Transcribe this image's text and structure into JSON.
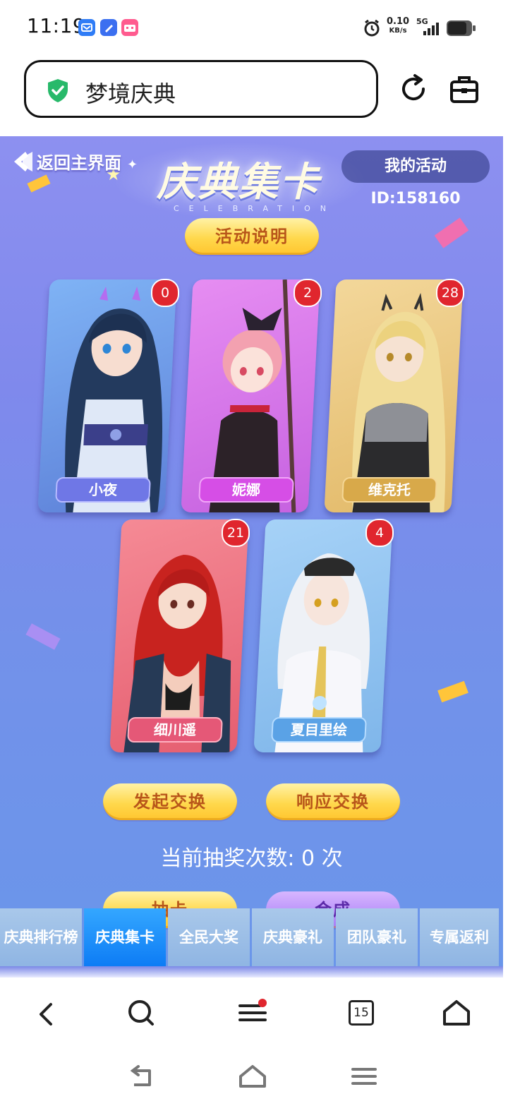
{
  "status_bar": {
    "time": "11:19",
    "net_speed_value": "0.10",
    "net_speed_unit": "KB/s",
    "network": "5G",
    "app_icons": [
      "mail-app-icon",
      "note-app-icon",
      "bilibili-app-icon"
    ]
  },
  "address_bar": {
    "title": "梦境庆典",
    "security_icon": "shield-check-icon"
  },
  "game": {
    "back_label": "返回主界面",
    "logo_title": "庆典集卡",
    "logo_subtitle": "CELEBRATION",
    "activity_id_label": "我的活动ID:158160",
    "rules_button": "活动说明",
    "cards": [
      {
        "name": "小夜",
        "count": "0"
      },
      {
        "name": "妮娜",
        "count": "2"
      },
      {
        "name": "维克托",
        "count": "28"
      },
      {
        "name": "细川遥",
        "count": "21"
      },
      {
        "name": "夏目里绘",
        "count": "4"
      }
    ],
    "initiate_exchange_button": "发起交换",
    "respond_exchange_button": "响应交换",
    "draw_count_text": "当前抽奖次数: 0 次",
    "draw_card_button": "抽卡",
    "compose_button": "合成",
    "tabs": [
      {
        "label": "庆典排行榜",
        "active": false
      },
      {
        "label": "庆典集卡",
        "active": true
      },
      {
        "label": "全民大奖",
        "active": false
      },
      {
        "label": "庆典豪礼",
        "active": false
      },
      {
        "label": "团队豪礼",
        "active": false
      },
      {
        "label": "专属返利",
        "active": false
      }
    ]
  },
  "browser_nav": {
    "tab_count": "15",
    "icons": [
      "back-icon",
      "search-icon",
      "menu-icon",
      "tabs-icon",
      "home-icon"
    ]
  },
  "colors": {
    "accent_blue": "#0d7cf5",
    "badge_red": "#e0262e",
    "button_yellow": "#ffd84c"
  }
}
